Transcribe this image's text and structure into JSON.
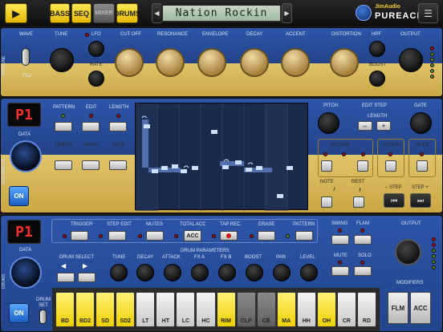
{
  "topbar": {
    "play_label": "▶",
    "tabs": [
      {
        "label": "BASS",
        "state": "on"
      },
      {
        "label": "SEQ",
        "state": "on"
      },
      {
        "label": "MIXER",
        "state": "off"
      },
      {
        "label": "DRUMS",
        "state": "on"
      }
    ],
    "prev_label": "◀",
    "next_label": "▶",
    "preset_name": "Nation Rockin",
    "logo_brand": "JimAudio",
    "logo_name": "PUREACID",
    "menu_label": "☰"
  },
  "bassline": {
    "side_label": "BASSLINE",
    "labels": {
      "wave": "WAVE",
      "tune": "TUNE",
      "lfo": "LFO",
      "rate": "RATE",
      "cutoff": "CUT OFF",
      "resonance": "RESONANCE",
      "envelope": "ENVELOPE",
      "decay": "DECAY",
      "accent": "ACCENT",
      "distortion": "DISTORTION",
      "hpf": "HPF",
      "boost": "BOOST",
      "output": "OUTPUT"
    }
  },
  "sequencer": {
    "side_label": "SEQUENCER",
    "pattern_display": "P1",
    "data_label": "DATA",
    "on_label": "ON",
    "labels": {
      "pattern": "PATTERN",
      "edit": "EDIT",
      "length": "LENGTH",
      "tempo": "TEMPO",
      "swing": "SWING",
      "gate": "GATE",
      "pitch": "PITCH",
      "edit_step": "EDIT STEP",
      "gate_r": "GATE",
      "length_r": "LENGTH",
      "octave": "OCTAVE",
      "accent": "ACCENT",
      "slide": "SLIDE",
      "note": "NOTE",
      "rest": "REST",
      "step_prev": "– STEP",
      "step_next": "STEP +"
    },
    "minus_label": "–",
    "plus_label": "+"
  },
  "drums": {
    "side_label": "DRUMS",
    "pattern_display": "P1",
    "data_label": "DATA",
    "on_label": "ON",
    "drumset_label": "DRUM SET",
    "labels": {
      "trigger": "TRIGGER",
      "step_edit": "STEP EDIT",
      "mutes": "MUTES",
      "total_acc": "TOTAL ACC",
      "tap_rec": "TAP REC",
      "erase": "ERASE",
      "pattern": "PATTERN",
      "swing": "SWING",
      "flam": "FLAM",
      "output": "OUTPUT",
      "mute": "MUTE",
      "solo": "SOLO",
      "drum_select": "DRUM SELECT",
      "drum_params": "DRUM PARAMETERS",
      "modifiers": "MODIFIERS"
    },
    "acc_label": "ACC",
    "params": [
      "TUNE",
      "DECAY",
      "ATTACK",
      "FX A",
      "FX B",
      "BOOST",
      "PAN",
      "LEVEL"
    ],
    "pads": [
      {
        "label": "BD",
        "color": "y"
      },
      {
        "label": "BD2",
        "color": "y"
      },
      {
        "label": "SD",
        "color": "y"
      },
      {
        "label": "SD2",
        "color": "y"
      },
      {
        "label": "LT",
        "color": "w"
      },
      {
        "label": "HT",
        "color": "w"
      },
      {
        "label": "LC",
        "color": "w"
      },
      {
        "label": "HC",
        "color": "w"
      },
      {
        "label": "RIM",
        "color": "y"
      },
      {
        "label": "CLP",
        "color": "g"
      },
      {
        "label": "CB",
        "color": "g"
      },
      {
        "label": "MA",
        "color": "y"
      },
      {
        "label": "HH",
        "color": "w"
      },
      {
        "label": "OH",
        "color": "y"
      },
      {
        "label": "CR",
        "color": "w"
      },
      {
        "label": "RD",
        "color": "w"
      }
    ],
    "modifiers": [
      "FLM",
      "ACC"
    ]
  }
}
